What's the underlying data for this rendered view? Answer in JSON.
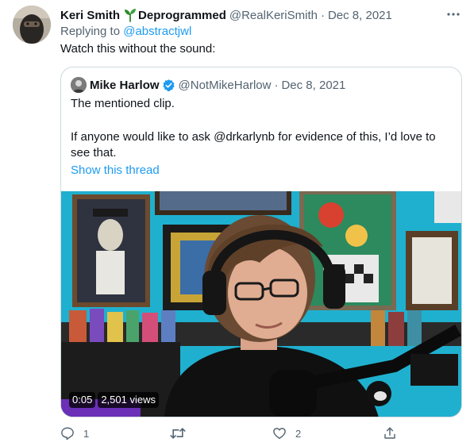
{
  "tweet": {
    "author_name": "Keri Smith",
    "author_suffix": "Deprogrammed",
    "author_handle": "@RealKeriSmith",
    "separator": "·",
    "date": "Dec 8, 2021",
    "reply_prefix": "Replying to",
    "reply_handle": "@abstractjwl",
    "text": "Watch this without the sound:",
    "more_icon": "more-horizontal-icon"
  },
  "quote": {
    "author_name": "Mike Harlow",
    "author_handle": "@NotMikeHarlow",
    "separator": "·",
    "date": "Dec 8, 2021",
    "text_line1": "The mentioned clip.",
    "text_body": "If anyone would like to ask @drkarlynb for evidence of this, I’d love to see that.",
    "show_thread": "Show this thread",
    "video": {
      "timestamp": "0:05",
      "views": "2,501 views"
    }
  },
  "actions": {
    "reply_count": "1",
    "retweet_count": "",
    "like_count": "2",
    "share_count": ""
  },
  "colors": {
    "link": "#1d9bf0",
    "secondary_text": "#536471",
    "border": "#cfd9de",
    "verified": "#1d9bf0",
    "sprout": "#2e8b2e"
  }
}
